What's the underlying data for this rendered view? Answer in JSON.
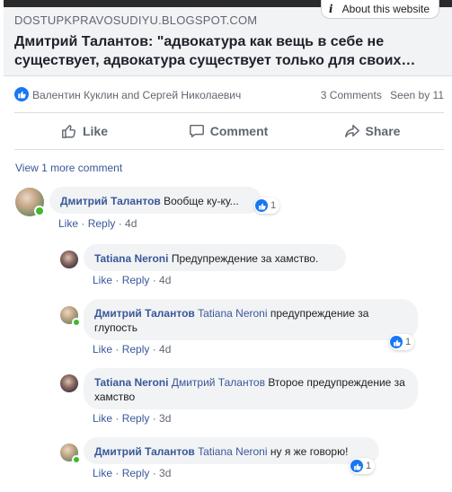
{
  "link_preview": {
    "domain": "DOSTUPKPRAVOSUDIYU.BLOGSPOT.COM",
    "title": "Дмитрий Талантов: \"адвокатура как вещь в себе не существует, адвокатура существует только для своих…",
    "about_label": "About this website"
  },
  "stats": {
    "likers": "Валентин Куклин and Сергей Николаевич",
    "comments": "3 Comments",
    "seen": "Seen by 11"
  },
  "actions": {
    "like": "Like",
    "comment": "Comment",
    "share": "Share"
  },
  "view_more": "View 1 more comment",
  "comments": [
    {
      "author": "Дмитрий Талантов",
      "mention": "",
      "text": "Вообще ку-ку...",
      "like": "Like",
      "reply": "Reply",
      "time": "4d",
      "reactions": "1"
    },
    {
      "author": "Tatiana Neroni",
      "mention": "",
      "text": "Предупреждение за хамство.",
      "like": "Like",
      "reply": "Reply",
      "time": "4d",
      "reactions": ""
    },
    {
      "author": "Дмитрий Талантов",
      "mention": "Tatiana Neroni",
      "text": "предупреждение за глупость",
      "like": "Like",
      "reply": "Reply",
      "time": "4d",
      "reactions": "1"
    },
    {
      "author": "Tatiana Neroni",
      "mention": "Дмитрий Талантов",
      "text": "Второе предупреждение за хамство",
      "like": "Like",
      "reply": "Reply",
      "time": "3d",
      "reactions": ""
    },
    {
      "author": "Дмитрий Талантов",
      "mention": "Tatiana Neroni",
      "text": "ну я же говорю!",
      "like": "Like",
      "reply": "Reply",
      "time": "3d",
      "reactions": "1"
    }
  ],
  "colors": {
    "link": "#385898",
    "like_blue": "#1877f2",
    "bubble": "#f2f3f5",
    "online": "#42b72a"
  },
  "icons": [
    "info-icon",
    "like-reaction-icon",
    "thumbs-up-icon",
    "comment-icon",
    "share-icon"
  ]
}
